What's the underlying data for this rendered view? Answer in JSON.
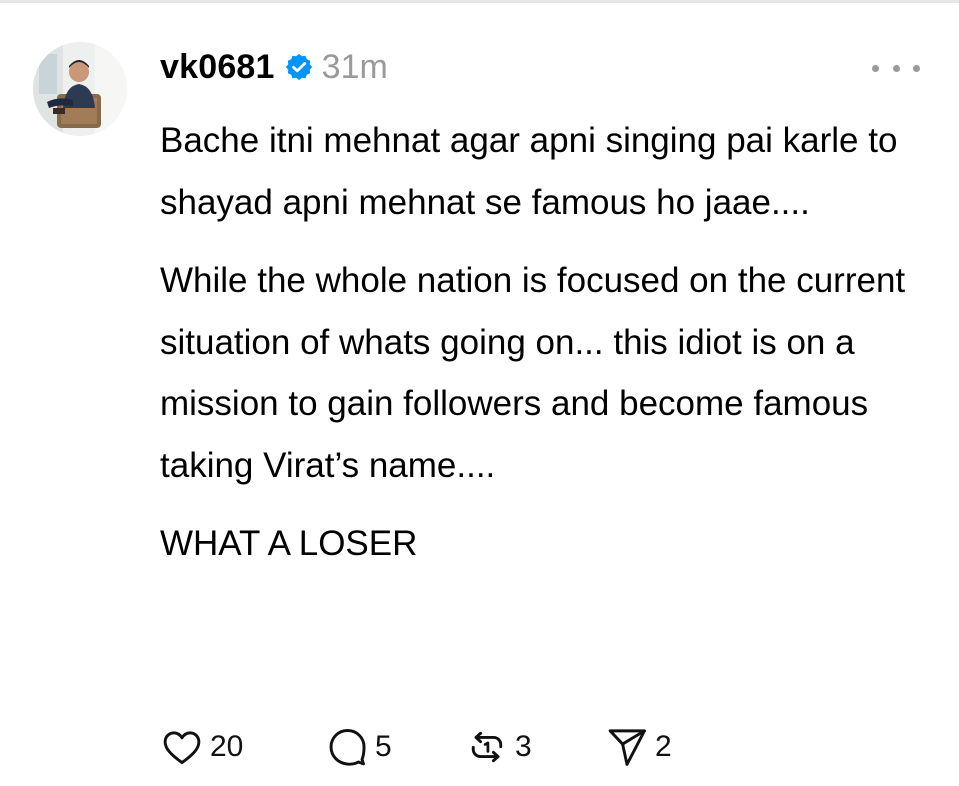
{
  "post": {
    "username": "vk0681",
    "verified": true,
    "timestamp": "31m",
    "paragraphs": [
      "Bache itni mehnat agar apni singing pai karle to shayad apni mehnat se famous ho jaae....",
      "While the whole nation is focused on the current situation of whats going on... this idiot is on a mission to gain followers and become famous taking Virat’s name....",
      "WHAT A LOSER"
    ],
    "actions": {
      "likes": "20",
      "comments": "5",
      "reposts": "3",
      "shares": "2"
    }
  },
  "icons": {
    "avatar": "profile-photo",
    "verified": "verified-badge-icon",
    "more": "more-options-icon",
    "like": "heart-icon",
    "comment": "comment-bubble-icon",
    "repost": "repost-icon",
    "share": "send-icon"
  },
  "colors": {
    "verified_badge": "#0095f6",
    "muted_text": "#9a9a9a",
    "text": "#000000"
  }
}
